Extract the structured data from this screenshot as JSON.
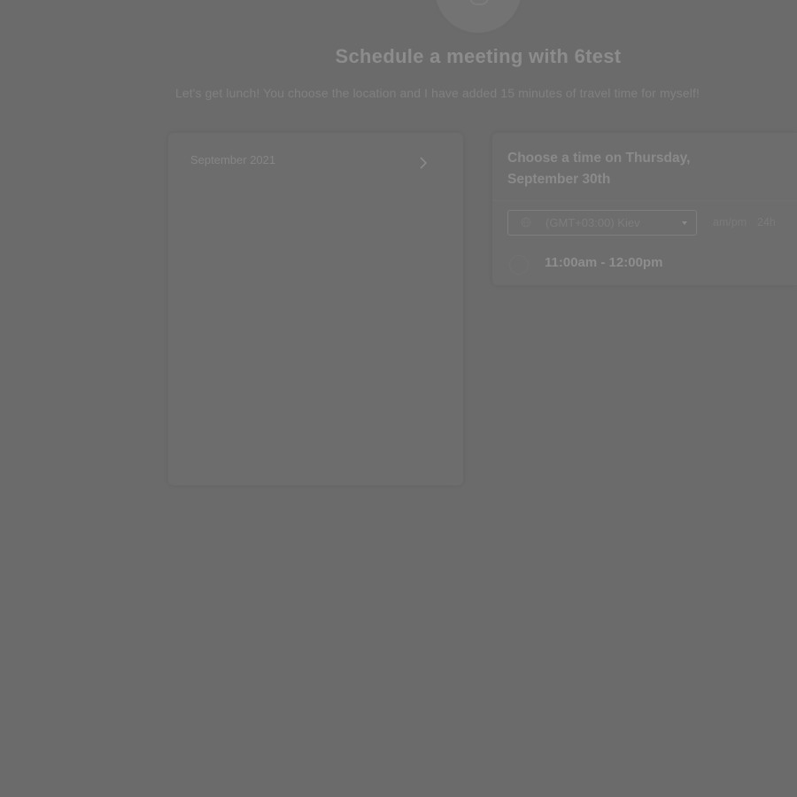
{
  "header": {
    "title": "Schedule a meeting with 6test",
    "subtitle": "Let's get lunch! You choose the location and I have added 15 minutes of travel time for myself!"
  },
  "calendar": {
    "month_label": "September 2021",
    "next_icon": "chevron-right-icon"
  },
  "time_picker": {
    "heading": "Choose a time on Thursday, September 30th",
    "timezone": {
      "icon": "globe-icon",
      "value": "(GMT+03:00) Kiev"
    },
    "format_options": [
      "am/pm",
      "24h"
    ],
    "slots": [
      {
        "label": "11:00am - 12:00pm"
      }
    ]
  },
  "colors": {
    "overlay": "#6b6b6b",
    "panel": "#6d6d6d",
    "text": "#8a8a8a"
  }
}
